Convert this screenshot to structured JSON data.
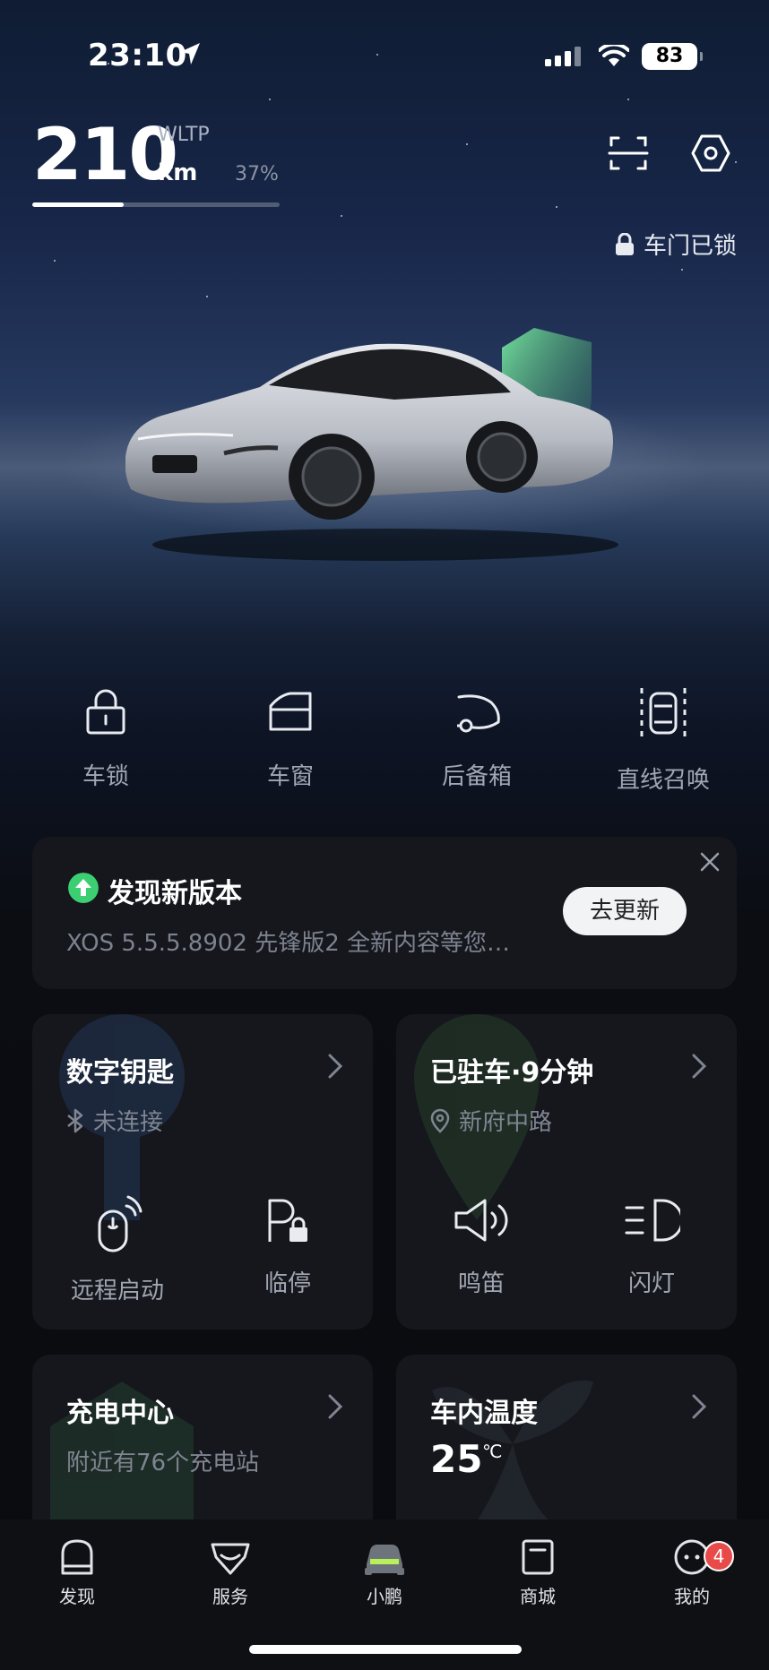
{
  "status_bar": {
    "time": "23:10",
    "battery": "83"
  },
  "range": {
    "value": "210",
    "standard": "WLTP",
    "unit": "km",
    "percent": "37%",
    "percent_fraction": 0.37
  },
  "lock_status": "车门已锁",
  "quick_controls": [
    {
      "label": "车锁",
      "icon": "lock-icon"
    },
    {
      "label": "车窗",
      "icon": "window-icon"
    },
    {
      "label": "后备箱",
      "icon": "trunk-icon"
    },
    {
      "label": "直线召唤",
      "icon": "summon-icon"
    }
  ],
  "update": {
    "title": "发现新版本",
    "description": "XOS 5.5.5.8902 先锋版2 全新内容等您查看",
    "button": "去更新"
  },
  "digital_key": {
    "title": "数字钥匙",
    "status": "未连接",
    "actions": [
      {
        "label": "远程启动",
        "icon": "remote-start-icon"
      },
      {
        "label": "临停",
        "icon": "temp-park-icon"
      }
    ]
  },
  "parking": {
    "title": "已驻车·9分钟",
    "location": "新府中路",
    "actions": [
      {
        "label": "鸣笛",
        "icon": "horn-icon"
      },
      {
        "label": "闪灯",
        "icon": "flash-lights-icon"
      }
    ]
  },
  "charging": {
    "title": "充电中心",
    "subtitle": "附近有76个充电站"
  },
  "cabin_temp": {
    "title": "车内温度",
    "value": "25",
    "unit": "℃"
  },
  "tabs": [
    {
      "label": "发现",
      "icon": "discover-icon"
    },
    {
      "label": "服务",
      "icon": "service-icon"
    },
    {
      "label": "小鹏",
      "icon": "car-icon"
    },
    {
      "label": "商城",
      "icon": "store-icon"
    },
    {
      "label": "我的",
      "icon": "profile-icon",
      "badge": "4"
    }
  ],
  "colors": {
    "accent_green": "#3ccf72",
    "badge_red": "#e84a4a",
    "card_bg": "#15171d"
  }
}
